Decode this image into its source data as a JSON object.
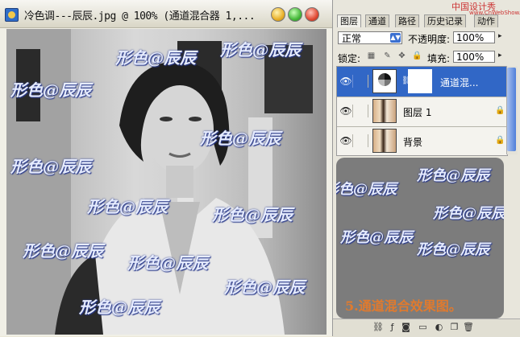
{
  "document": {
    "title": "冷色调---辰辰.jpg @ 100% (通道混合器 1,...",
    "watermark": "形色@辰辰"
  },
  "site_watermark": {
    "line1": "中国设计秀",
    "line2": "www.CnWebShow.com"
  },
  "layers_panel": {
    "tabs": [
      "图层",
      "通道",
      "路径",
      "历史记录",
      "动作"
    ],
    "blend_mode": "正常",
    "opacity_label": "不透明度:",
    "opacity_value": "100%",
    "lock_label": "锁定:",
    "fill_label": "填充:",
    "fill_value": "100%",
    "layers": [
      {
        "name": "通道混...",
        "type": "adjustment",
        "selected": true,
        "visible": true
      },
      {
        "name": "图层 1",
        "type": "photo",
        "selected": false,
        "visible": true,
        "locked": true
      },
      {
        "name": "背景",
        "type": "photo",
        "selected": false,
        "visible": true,
        "locked": true
      }
    ],
    "icons": [
      "eye-icon",
      "link-icon",
      "lock-icon",
      "brush-icon",
      "move-icon"
    ],
    "footer_icons": [
      "link-layers-icon",
      "add-style-icon",
      "add-mask-icon",
      "new-group-icon",
      "new-adjustment-icon",
      "new-layer-icon",
      "delete-layer-icon"
    ]
  },
  "caption": "5.通道混合效果图。",
  "colors": {
    "selection": "#3167c6",
    "caption": "#e07a2e",
    "note_bg": "#7c7c7c"
  }
}
